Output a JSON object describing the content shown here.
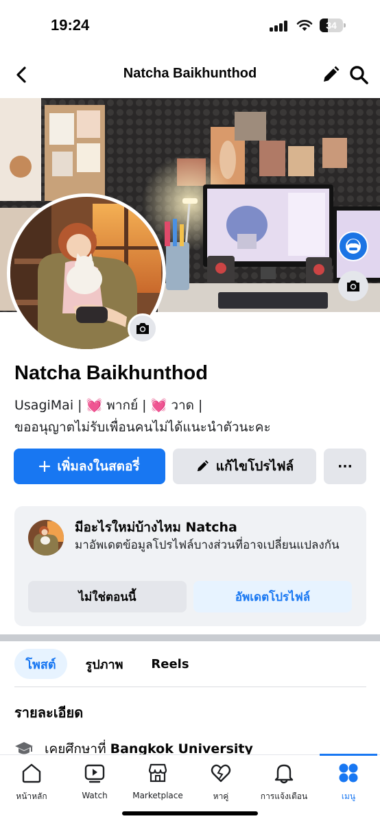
{
  "status_bar": {
    "time": "19:24",
    "battery": "34",
    "battery_level": 0.34
  },
  "header": {
    "title": "Natcha Baikhunthod"
  },
  "profile": {
    "name": "Natcha Baikhunthod",
    "bio_line1_a": "UsagiMai | ",
    "bio_heart": "💓",
    "bio_line1_b": " พากย์ | ",
    "bio_line1_c": " วาด |",
    "bio_line2": "ขออนุญาตไม่รับเพื่อนคนไม่ได้แนะนำตัวนะคะ"
  },
  "actions": {
    "add_story": "เพิ่มลงในสตอรี่",
    "edit_profile": "แก้ไขโปรไฟล์",
    "more": "···"
  },
  "update_card": {
    "title": "มีอะไรใหม่บ้างไหม Natcha",
    "description": "มาอัพเดตข้อมูลโปรไฟล์บางส่วนที่อาจเปลี่ยนแปลงกัน",
    "not_now": "ไม่ใช่ตอนนี้",
    "update": "อัพเดตโปรไฟล์"
  },
  "tabs": [
    {
      "label": "โพสต์",
      "active": true
    },
    {
      "label": "รูปภาพ",
      "active": false
    },
    {
      "label": "Reels",
      "active": false
    }
  ],
  "details": {
    "title": "รายละเอียด",
    "education_prefix": "เคยศึกษาที่ ",
    "education_school": "Bangkok University"
  },
  "bottom_nav": [
    {
      "label": "หน้าหลัก",
      "icon": "home-icon"
    },
    {
      "label": "Watch",
      "icon": "watch-icon"
    },
    {
      "label": "Marketplace",
      "icon": "marketplace-icon"
    },
    {
      "label": "หาคู่",
      "icon": "dating-icon"
    },
    {
      "label": "การแจ้งเตือน",
      "icon": "bell-icon"
    },
    {
      "label": "เมนู",
      "icon": "menu-icon",
      "active": true
    }
  ],
  "colors": {
    "accent": "#1877f2",
    "button_gray": "#e4e6eb",
    "card_bg": "#f0f2f5"
  }
}
